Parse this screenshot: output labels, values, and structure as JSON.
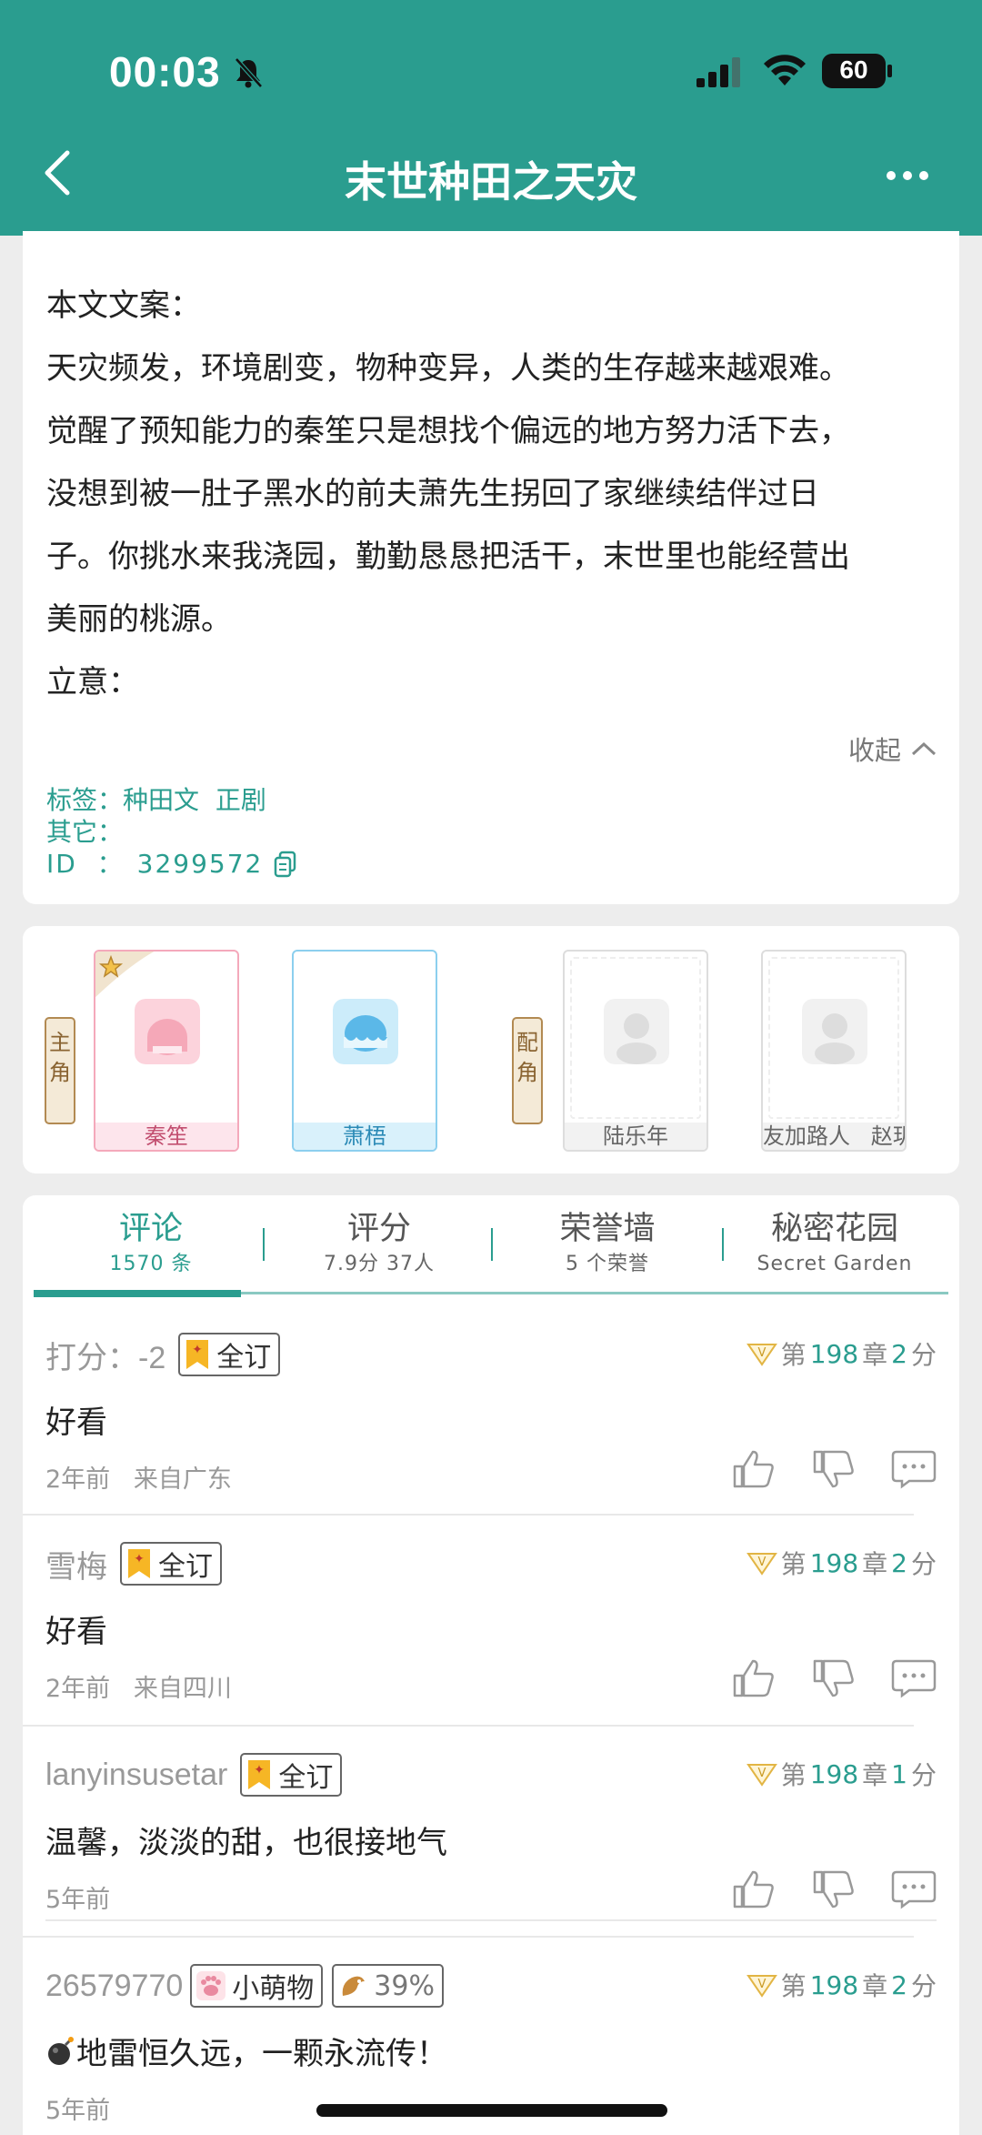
{
  "status_bar": {
    "time": "00:03",
    "battery": "60"
  },
  "header": {
    "title": "末世种田之天灾"
  },
  "synopsis": {
    "lines": [
      "本文文案：",
      "天灾频发，环境剧变，物种变异，人类的生存越来越艰难。",
      "觉醒了预知能力的秦笙只是想找个偏远的地方努力活下去，",
      "没想到被一肚子黑水的前夫萧先生拐回了家继续结伴过日",
      "子。你挑水来我浇园，勤勤恳恳把活干，末世里也能经营出",
      "美丽的桃源。",
      "立意："
    ],
    "collapse_label": "收起",
    "tags_label": "标签：",
    "tags": "种田文  正剧",
    "other_label": "其它：",
    "id_label": "ID  ：",
    "id_value": "3299572"
  },
  "characters": {
    "main_tag": [
      "主",
      "角"
    ],
    "support_tag": [
      "配",
      "角"
    ],
    "main": [
      {
        "name": "秦笙"
      },
      {
        "name": "萧梧"
      }
    ],
    "support": [
      {
        "name": "陆乐年"
      },
      {
        "name": "友加路人   赵玥"
      }
    ]
  },
  "tabs": [
    {
      "label": "评论",
      "sub": "1570 条"
    },
    {
      "label": "评分",
      "sub": "7.9分 37人"
    },
    {
      "label": "荣誉墙",
      "sub": "5 个荣誉"
    },
    {
      "label": "秘密花园",
      "sub": "Secret Garden"
    }
  ],
  "comments": [
    {
      "user": "打分：-2",
      "badge": "全订",
      "ch_prefix": "第",
      "chapter": "198",
      "ch_mid": "章",
      "score": "2",
      "ch_suffix": "分",
      "body": "好看",
      "meta": "2年前   来自广东"
    },
    {
      "user": "雪梅",
      "badge": "全订",
      "ch_prefix": "第",
      "chapter": "198",
      "ch_mid": "章",
      "score": "2",
      "ch_suffix": "分",
      "body": "好看",
      "meta": "2年前   来自四川"
    },
    {
      "user": "lanyinsusetar",
      "badge": "全订",
      "ch_prefix": "第",
      "chapter": "198",
      "ch_mid": "章",
      "score": "1",
      "ch_suffix": "分",
      "body": "温馨，淡淡的甜，也很接地气",
      "meta": "5年前"
    },
    {
      "user": "26579770",
      "badge": "小萌物",
      "badge2": "39%",
      "ch_prefix": "第",
      "chapter": "198",
      "ch_mid": "章",
      "score": "2",
      "ch_suffix": "分",
      "body": "地雷恒久远，一颗永流传！",
      "meta": "5年前"
    }
  ],
  "colors": {
    "accent": "#2a9d8f",
    "background": "#ededed",
    "card": "#ffffff"
  }
}
